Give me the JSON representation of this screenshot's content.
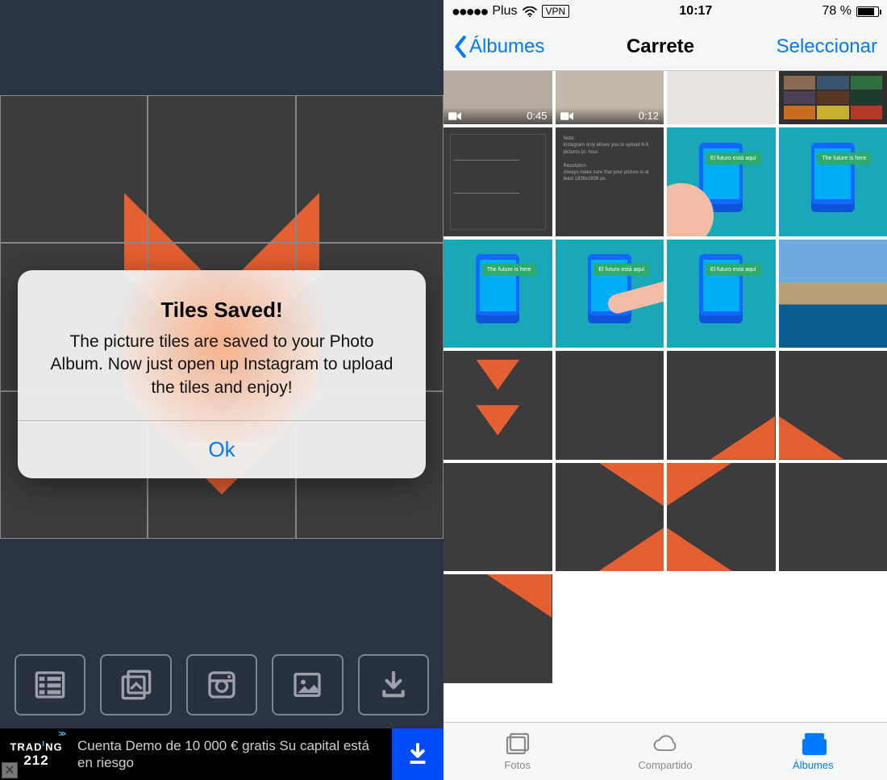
{
  "left": {
    "modal": {
      "title": "Tiles Saved!",
      "body": "The picture tiles are saved to your Photo Album. Now just open up Instagram to upload the tiles and enjoy!",
      "ok": "Ok"
    },
    "toolbar": {
      "layout_icon": "layout-icon",
      "browse_icon": "browse-icon",
      "instagram_icon": "instagram-icon",
      "image_icon": "image-icon",
      "download_icon": "download-icon"
    },
    "ad": {
      "brand_line1": "TRAD",
      "brand_line2": "NG",
      "brand_212": "212",
      "brand_chevrons": ">>",
      "text": "Cuenta Demo de 10 000 € gratis Su capital está en riesgo",
      "close": "✕"
    },
    "colors": {
      "bg": "#2a3443",
      "tile_bg": "#3c3c3c",
      "logo": "#e45f31"
    }
  },
  "right": {
    "status": {
      "carrier": "Plus",
      "vpn": "VPN",
      "time": "10:17",
      "battery_pct": "78 %"
    },
    "nav": {
      "back": "Álbumes",
      "title": "Carrete",
      "action": "Seleccionar"
    },
    "thumbs": {
      "video1_duration": "0:45",
      "video2_duration": "0:12",
      "phone_label_en": "The future is here",
      "phone_label_es": "El futuro está aquí"
    },
    "tabs": {
      "photos": "Fotos",
      "shared": "Compartido",
      "albums": "Álbumes"
    },
    "colors": {
      "ios_blue": "#007aff",
      "teal": "#1aa8b8",
      "tile_orange": "#e45f31"
    }
  }
}
